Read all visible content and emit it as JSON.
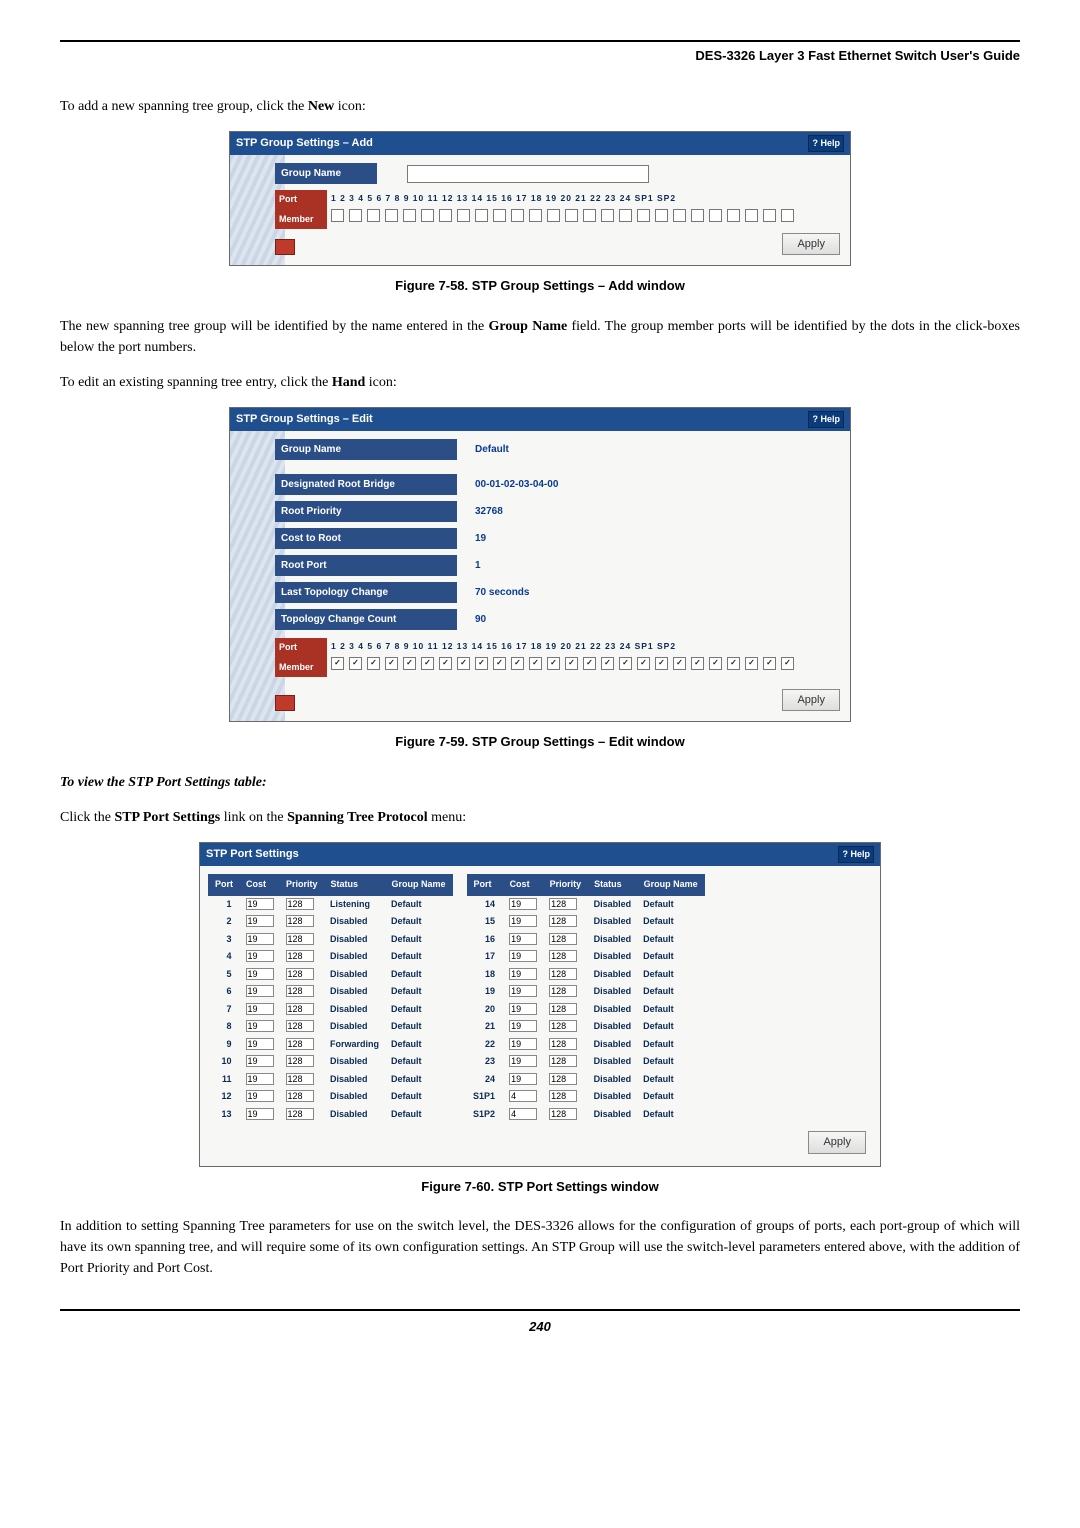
{
  "header": "DES-3326 Layer 3 Fast Ethernet Switch User's Guide",
  "intro_add": {
    "pre": "To add a new spanning tree group, click the ",
    "bold": "New",
    "post": " icon:"
  },
  "fig58_caption": "Figure 7-58.  STP Group Settings – Add window",
  "add_panel": {
    "title": "STP Group Settings – Add",
    "help": "? Help",
    "group_name_label": "Group Name",
    "port_label": "Port",
    "member_label": "Member",
    "port_header": "1  2  3  4  5  6  7  8  9 10 11 12 13 14 15 16 17 18 19 20 21 22 23 24 SP1 SP2",
    "apply": "Apply"
  },
  "after_add": {
    "pre": "The new spanning tree group will be identified by the name entered in the ",
    "b1": "Group Name",
    "mid": " field. The group member ports will be identified by the dots in the click-boxes below the port numbers."
  },
  "intro_edit": {
    "pre": "To edit an existing spanning tree entry, click the ",
    "bold": "Hand",
    "post": " icon:"
  },
  "edit_panel": {
    "title": "STP Group Settings – Edit",
    "help": "? Help",
    "rows": [
      {
        "label": "Group Name",
        "value": "Default"
      },
      {
        "label": "Designated Root Bridge",
        "value": "00-01-02-03-04-00"
      },
      {
        "label": "Root Priority",
        "value": "32768"
      },
      {
        "label": "Cost to Root",
        "value": "19"
      },
      {
        "label": "Root Port",
        "value": "1"
      },
      {
        "label": "Last Topology Change",
        "value": "70 seconds"
      },
      {
        "label": "Topology Change Count",
        "value": "90"
      }
    ],
    "port_label": "Port",
    "member_label": "Member",
    "port_header": "1  2  3  4  5  6  7  8  9 10 11 12 13 14 15 16 17 18 19 20 21 22 23 24 SP1 SP2",
    "apply": "Apply"
  },
  "fig59_caption": "Figure 7-59.  STP Group Settings – Edit window",
  "view_heading": "To view the STP Port Settings table:",
  "view_line": {
    "pre": "Click the ",
    "b1": "STP Port Settings",
    "mid": " link on the ",
    "b2": "Spanning Tree Protocol",
    "post": " menu:"
  },
  "ports_panel": {
    "title": "STP Port Settings",
    "help": "? Help",
    "cols": [
      "Port",
      "Cost",
      "Priority",
      "Status",
      "Group Name"
    ],
    "left": [
      {
        "port": "1",
        "cost": "19",
        "prio": "128",
        "status": "Listening",
        "grp": "Default"
      },
      {
        "port": "2",
        "cost": "19",
        "prio": "128",
        "status": "Disabled",
        "grp": "Default"
      },
      {
        "port": "3",
        "cost": "19",
        "prio": "128",
        "status": "Disabled",
        "grp": "Default"
      },
      {
        "port": "4",
        "cost": "19",
        "prio": "128",
        "status": "Disabled",
        "grp": "Default"
      },
      {
        "port": "5",
        "cost": "19",
        "prio": "128",
        "status": "Disabled",
        "grp": "Default"
      },
      {
        "port": "6",
        "cost": "19",
        "prio": "128",
        "status": "Disabled",
        "grp": "Default"
      },
      {
        "port": "7",
        "cost": "19",
        "prio": "128",
        "status": "Disabled",
        "grp": "Default"
      },
      {
        "port": "8",
        "cost": "19",
        "prio": "128",
        "status": "Disabled",
        "grp": "Default"
      },
      {
        "port": "9",
        "cost": "19",
        "prio": "128",
        "status": "Forwarding",
        "grp": "Default"
      },
      {
        "port": "10",
        "cost": "19",
        "prio": "128",
        "status": "Disabled",
        "grp": "Default"
      },
      {
        "port": "11",
        "cost": "19",
        "prio": "128",
        "status": "Disabled",
        "grp": "Default"
      },
      {
        "port": "12",
        "cost": "19",
        "prio": "128",
        "status": "Disabled",
        "grp": "Default"
      },
      {
        "port": "13",
        "cost": "19",
        "prio": "128",
        "status": "Disabled",
        "grp": "Default"
      }
    ],
    "right": [
      {
        "port": "14",
        "cost": "19",
        "prio": "128",
        "status": "Disabled",
        "grp": "Default"
      },
      {
        "port": "15",
        "cost": "19",
        "prio": "128",
        "status": "Disabled",
        "grp": "Default"
      },
      {
        "port": "16",
        "cost": "19",
        "prio": "128",
        "status": "Disabled",
        "grp": "Default"
      },
      {
        "port": "17",
        "cost": "19",
        "prio": "128",
        "status": "Disabled",
        "grp": "Default"
      },
      {
        "port": "18",
        "cost": "19",
        "prio": "128",
        "status": "Disabled",
        "grp": "Default"
      },
      {
        "port": "19",
        "cost": "19",
        "prio": "128",
        "status": "Disabled",
        "grp": "Default"
      },
      {
        "port": "20",
        "cost": "19",
        "prio": "128",
        "status": "Disabled",
        "grp": "Default"
      },
      {
        "port": "21",
        "cost": "19",
        "prio": "128",
        "status": "Disabled",
        "grp": "Default"
      },
      {
        "port": "22",
        "cost": "19",
        "prio": "128",
        "status": "Disabled",
        "grp": "Default"
      },
      {
        "port": "23",
        "cost": "19",
        "prio": "128",
        "status": "Disabled",
        "grp": "Default"
      },
      {
        "port": "24",
        "cost": "19",
        "prio": "128",
        "status": "Disabled",
        "grp": "Default"
      },
      {
        "port": "S1P1",
        "cost": "4",
        "prio": "128",
        "status": "Disabled",
        "grp": "Default"
      },
      {
        "port": "S1P2",
        "cost": "4",
        "prio": "128",
        "status": "Disabled",
        "grp": "Default"
      }
    ],
    "apply": "Apply"
  },
  "fig60_caption": "Figure 7-60.  STP Port Settings window",
  "closing": "In addition to setting Spanning Tree parameters for use on the switch level, the DES-3326 allows for the configuration of groups of ports, each port-group of which will have its own spanning tree, and will require some of its own configuration settings. An STP Group will use the switch-level parameters entered above, with the addition of Port Priority and Port Cost.",
  "page_no": "240"
}
